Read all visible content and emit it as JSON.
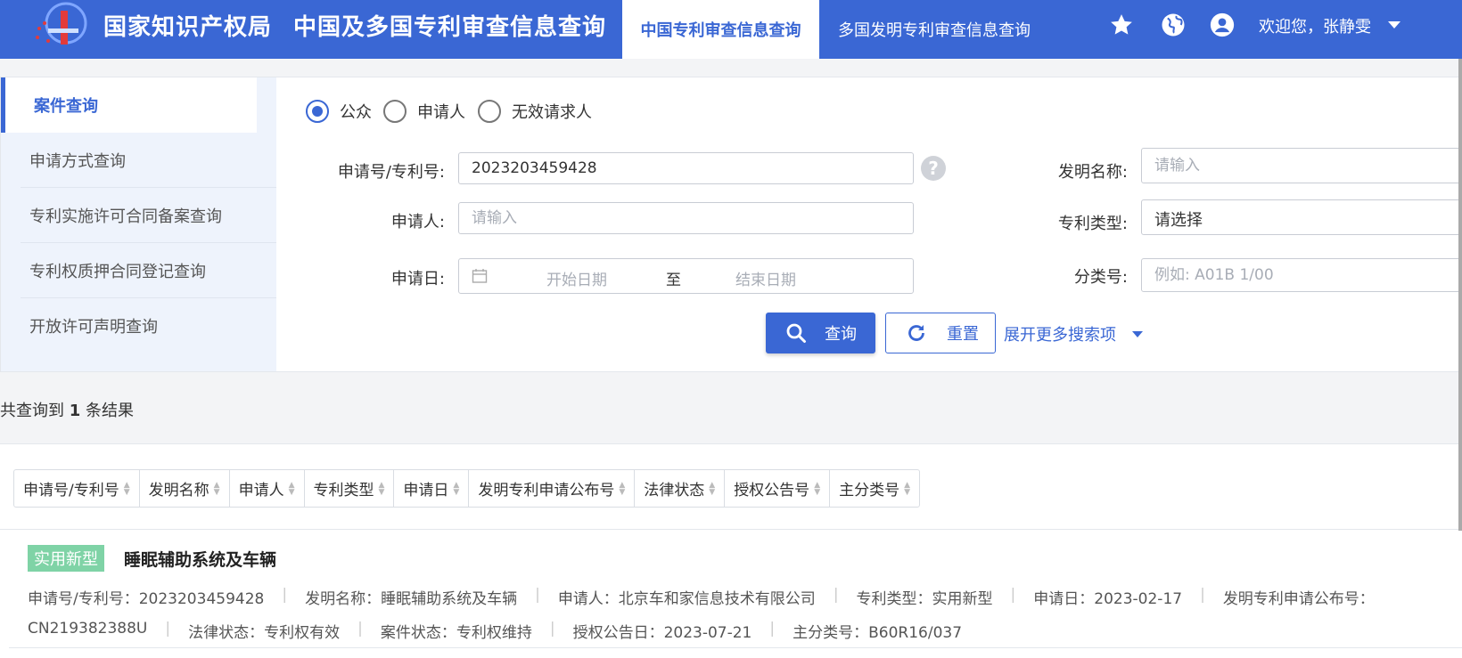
{
  "header": {
    "brand": "国家知识产权局",
    "app_title": "中国及多国专利审查信息查询",
    "tabs": [
      {
        "label": "中国专利审查信息查询",
        "active": true
      },
      {
        "label": "多国发明专利审查信息查询",
        "active": false
      }
    ],
    "icons": [
      "star-icon",
      "globe-icon",
      "user-icon"
    ],
    "welcome": "欢迎您，张静雯",
    "brand_color": "#3a67d4"
  },
  "sidebar": {
    "items": [
      {
        "label": "案件查询",
        "active": true
      },
      {
        "label": "申请方式查询",
        "active": false
      },
      {
        "label": "专利实施许可合同备案查询",
        "active": false
      },
      {
        "label": "专利权质押合同登记查询",
        "active": false
      },
      {
        "label": "开放许可声明查询",
        "active": false
      }
    ]
  },
  "search": {
    "roles": [
      {
        "label": "公众",
        "selected": true
      },
      {
        "label": "申请人",
        "selected": false
      },
      {
        "label": "无效请求人",
        "selected": false
      }
    ],
    "app_no_label": "申请号/专利号:",
    "app_no_value": "2023203459428",
    "help_glyph": "?",
    "applicant_label": "申请人:",
    "applicant_placeholder": "请输入",
    "date_label": "申请日:",
    "date_start_placeholder": "开始日期",
    "date_to": "至",
    "date_end_placeholder": "结束日期",
    "title_label": "发明名称:",
    "title_placeholder": "请输入",
    "type_label": "专利类型:",
    "type_value": "请选择",
    "class_label": "分类号:",
    "class_placeholder": "例如: A01B 1/00",
    "search_button": "查询",
    "reset_button": "重置",
    "expand_link": "展开更多搜索项"
  },
  "results": {
    "count_prefix": "共查询到",
    "count": "1",
    "count_suffix": "条结果",
    "sort_columns": [
      "申请号/专利号",
      "发明名称",
      "申请人",
      "专利类型",
      "申请日",
      "发明专利申请公布号",
      "法律状态",
      "授权公告号",
      "主分类号"
    ],
    "items": [
      {
        "badge": "实用新型",
        "title": "睡眠辅助系统及车辆",
        "line1": [
          "申请号/专利号：2023203459428",
          "发明名称：睡眠辅助系统及车辆",
          "申请人：北京车和家信息技术有限公司",
          "专利类型：实用新型",
          "申请日：2023-02-17",
          "发明专利申请公布号："
        ],
        "line2": [
          "CN219382388U",
          "法律状态：专利权有效",
          "案件状态：专利权维持",
          "授权公告日：2023-07-21",
          "主分类号：B60R16/037"
        ]
      }
    ]
  }
}
